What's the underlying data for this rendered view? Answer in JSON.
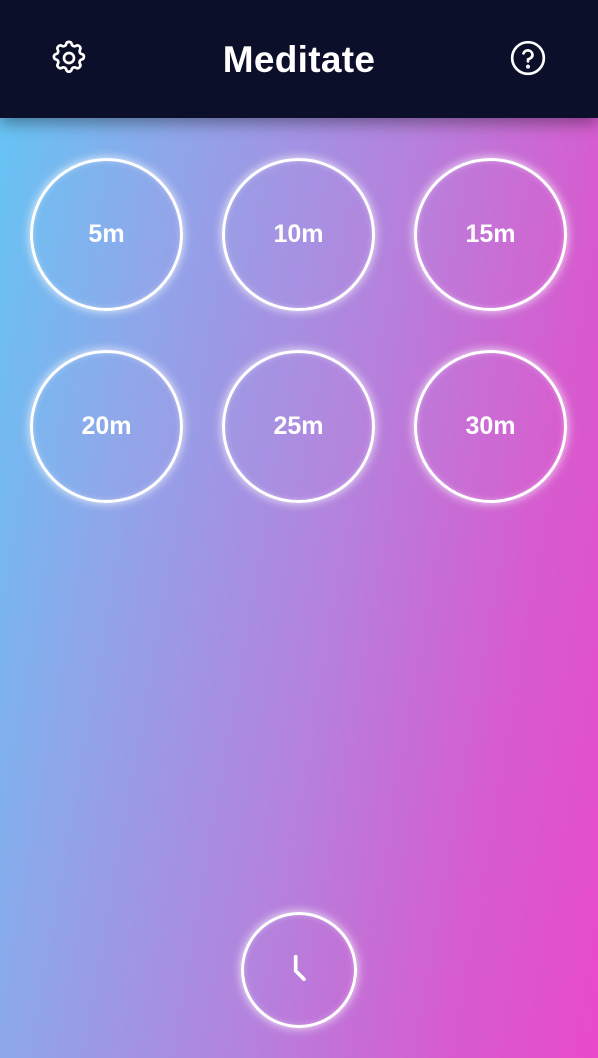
{
  "header": {
    "title": "Meditate",
    "settings_icon": "gear-icon",
    "help_icon": "question-circle-icon"
  },
  "durations": [
    "5m",
    "10m",
    "15m",
    "20m",
    "25m",
    "30m"
  ],
  "footer": {
    "history_icon": "clock-icon"
  },
  "colors": {
    "header_bg": "#0c0f29",
    "gradient_start": "#62c7f5",
    "gradient_end": "#e84acb",
    "ring": "#ffffff"
  }
}
